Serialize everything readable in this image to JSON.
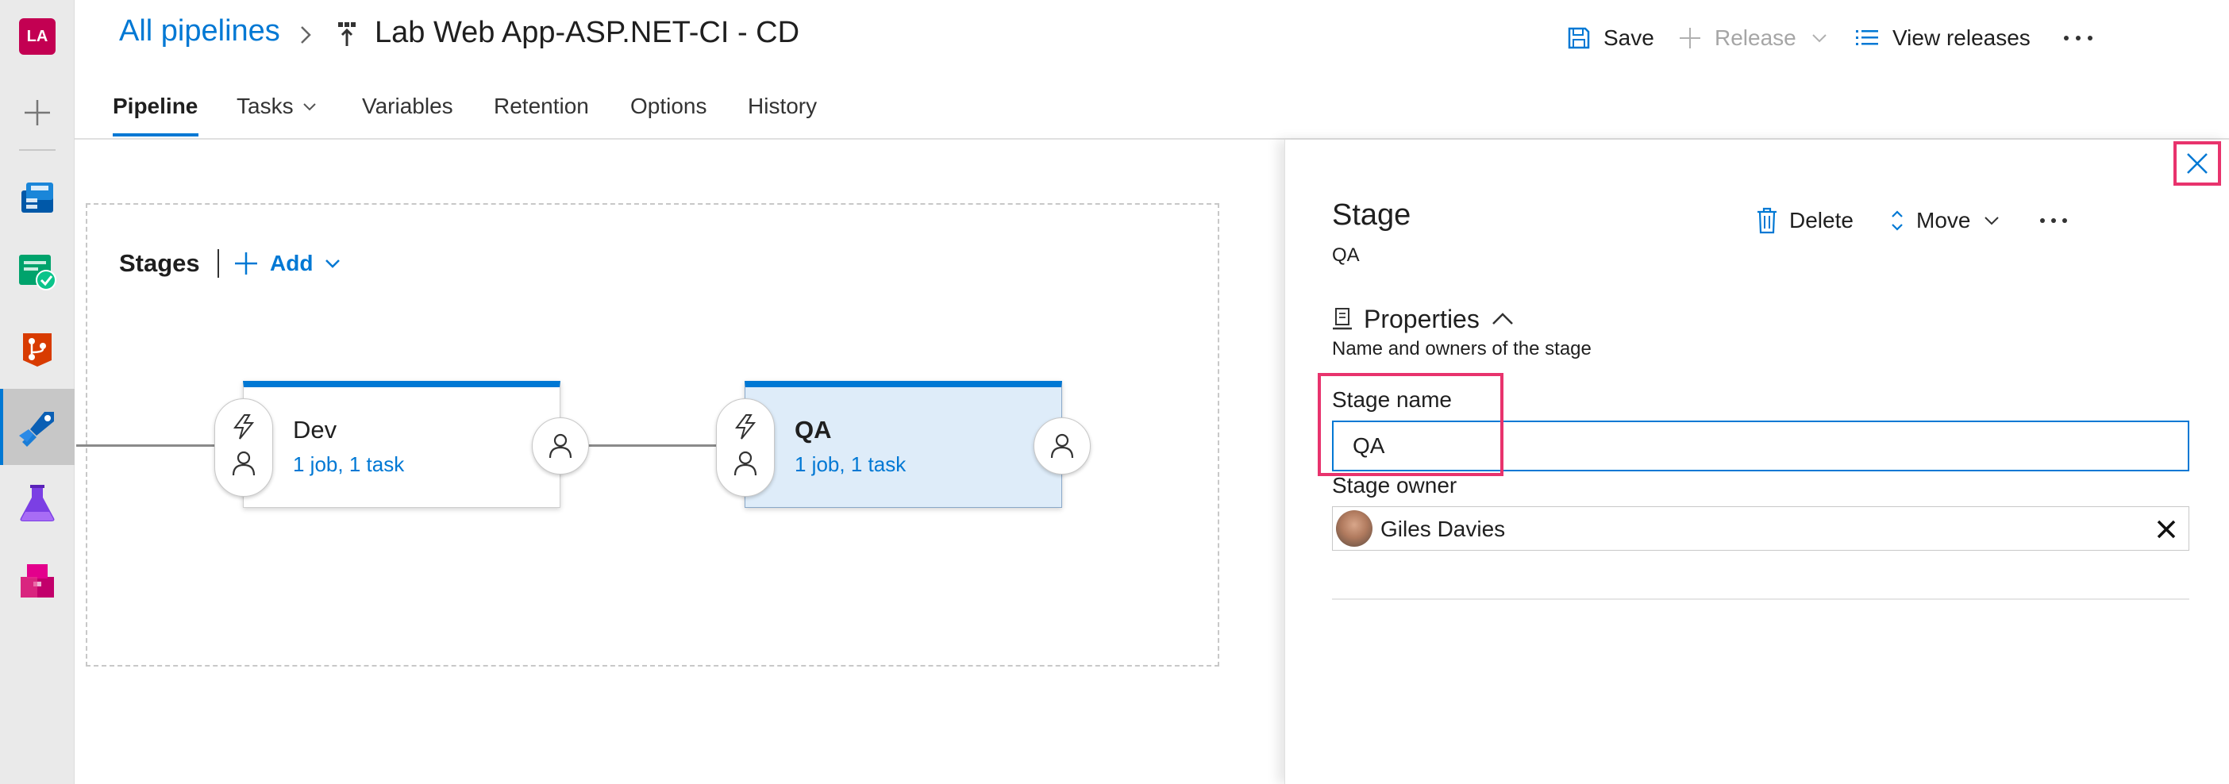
{
  "rail": {
    "avatar_initials": "LA",
    "items": [
      {
        "icon": "plus-icon"
      },
      {
        "icon": "boards-icon",
        "color": "#0078d4"
      },
      {
        "icon": "test-plans-check-icon",
        "color": "#009c5c"
      },
      {
        "icon": "repos-icon",
        "color": "#d83b01"
      },
      {
        "icon": "pipelines-icon",
        "color": "#0078d4",
        "active": true
      },
      {
        "icon": "test-flask-icon",
        "color": "#8a2be2"
      },
      {
        "icon": "artifacts-icon",
        "color": "#e3008c"
      }
    ]
  },
  "header": {
    "breadcrumb_all": "All pipelines",
    "pipeline_title": "Lab Web App-ASP.NET-CI - CD",
    "toolbar": {
      "save_label": "Save",
      "release_label": "Release",
      "view_releases_label": "View releases"
    }
  },
  "tabs": [
    {
      "label": "Pipeline",
      "active": true
    },
    {
      "label": "Tasks"
    },
    {
      "label": "Variables"
    },
    {
      "label": "Retention"
    },
    {
      "label": "Options"
    },
    {
      "label": "History"
    }
  ],
  "canvas": {
    "stages_label": "Stages",
    "add_label": "Add",
    "stages": [
      {
        "name": "Dev",
        "summary": "1 job, 1 task",
        "selected": false
      },
      {
        "name": "QA",
        "summary": "1 job, 1 task",
        "selected": true
      }
    ]
  },
  "panel": {
    "title": "Stage",
    "subtitle": "QA",
    "delete_label": "Delete",
    "move_label": "Move",
    "properties_title": "Properties",
    "properties_description": "Name and owners of the stage",
    "stage_name_label": "Stage name",
    "stage_name_value": "QA",
    "stage_owner_label": "Stage owner",
    "stage_owner_value": "Giles Davies"
  },
  "colors": {
    "accent": "#0078d4",
    "highlight": "#e8336d",
    "selected_stage_bg": "#deecf9"
  }
}
